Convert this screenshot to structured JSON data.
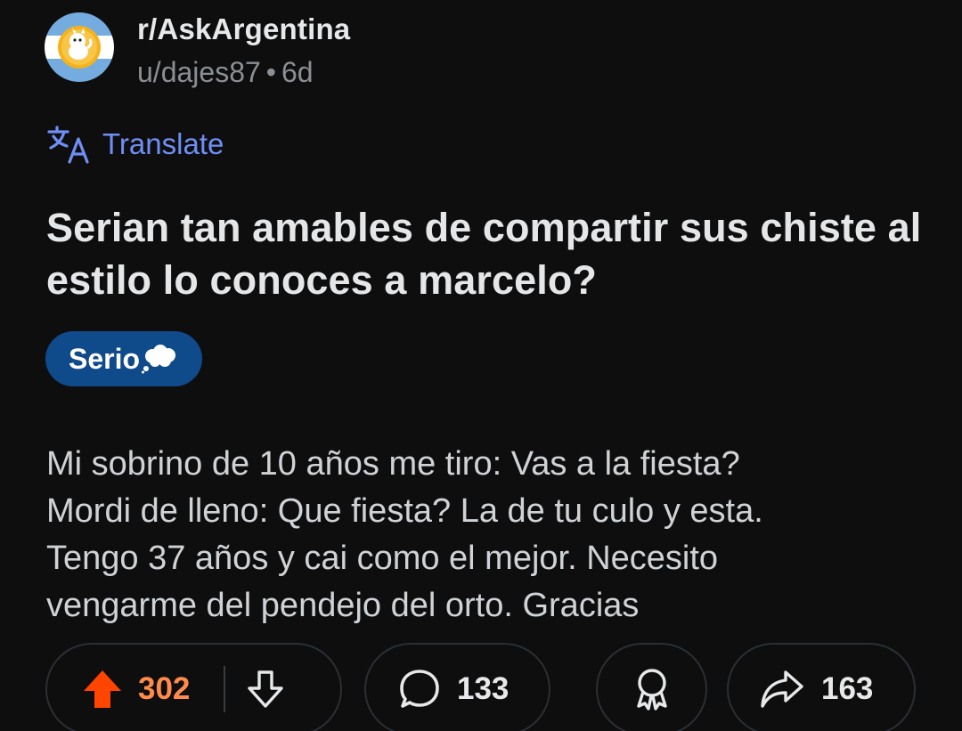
{
  "post": {
    "subreddit": "r/AskArgentina",
    "user": "u/dajes87",
    "separator": "•",
    "age": "6d",
    "translate_label": "Translate",
    "title": "Serian tan amables de compartir sus chiste al estilo lo conoces a marcelo?",
    "flair": "Serio",
    "body_lines": [
      "Mi sobrino de 10 años me tiro: Vas a la fiesta?",
      "Mordi de lleno: Que fiesta? La de tu culo y esta.",
      "Tengo 37 años y cai como el mejor. Necesito",
      "vengarme del pendejo del orto. Gracias"
    ]
  },
  "actions": {
    "upvotes": "302",
    "comments": "133",
    "shares": "163"
  },
  "colors": {
    "background": "#0e0e0f",
    "upvote_active": "#ff4500",
    "upvote_count": "#ff8a4c",
    "translate_link": "#6f8ff5",
    "flair_bg": "#0f4a8a"
  },
  "icons": {
    "avatar": "subreddit-avatar-argentina-flag",
    "translate": "translate-icon",
    "flair_emoji": "thought-balloon-emoji",
    "upvote": "upvote-arrow-icon",
    "downvote": "downvote-arrow-icon",
    "comment": "comment-bubble-icon",
    "award": "award-icon",
    "share": "share-arrow-icon"
  }
}
